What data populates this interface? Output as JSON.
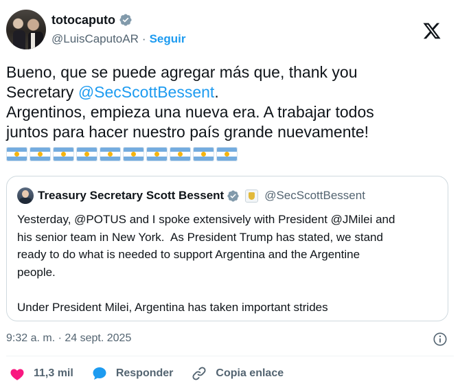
{
  "author": {
    "display_name": "totocaputo",
    "handle": "@LuisCaputoAR",
    "separator": "·",
    "follow_label": "Seguir"
  },
  "tweet": {
    "text_before": "Bueno, que se puede agregar más que, thank you\nSecretary ",
    "mention": "@SecScottBessent",
    "text_after": ".\nArgentinos, empieza una nueva era. A trabajar todos\njuntos para hacer nuestro país grande nuevamente!",
    "flag_count": 10
  },
  "quoted": {
    "display_name": "Treasury Secretary Scott Bessent",
    "handle": "@SecScottBessent",
    "text": "Yesterday, @POTUS and I spoke extensively with President @JMilei and\nhis senior team in New York.  As President Trump has stated, we stand\nready to do what is needed to support Argentina and the Argentine\npeople.\n\nUnder President Milei, Argentina has taken important strides"
  },
  "meta": {
    "timestamp": "9:32 a. m. · 24 sept. 2025"
  },
  "actions": {
    "likes_count": "11,3 mil",
    "reply_label": "Responder",
    "copy_link_label": "Copia enlace"
  },
  "icons": {
    "verified": "verified-badge-icon",
    "x_logo": "x-logo-icon",
    "info": "info-icon",
    "like": "heart-icon",
    "reply": "speech-bubble-icon",
    "copy_link": "link-icon"
  },
  "colors": {
    "accent": "#1d9bf0",
    "like": "#f91880",
    "secondary_text": "#536471",
    "text": "#0f1419",
    "border": "#cfd9de"
  }
}
